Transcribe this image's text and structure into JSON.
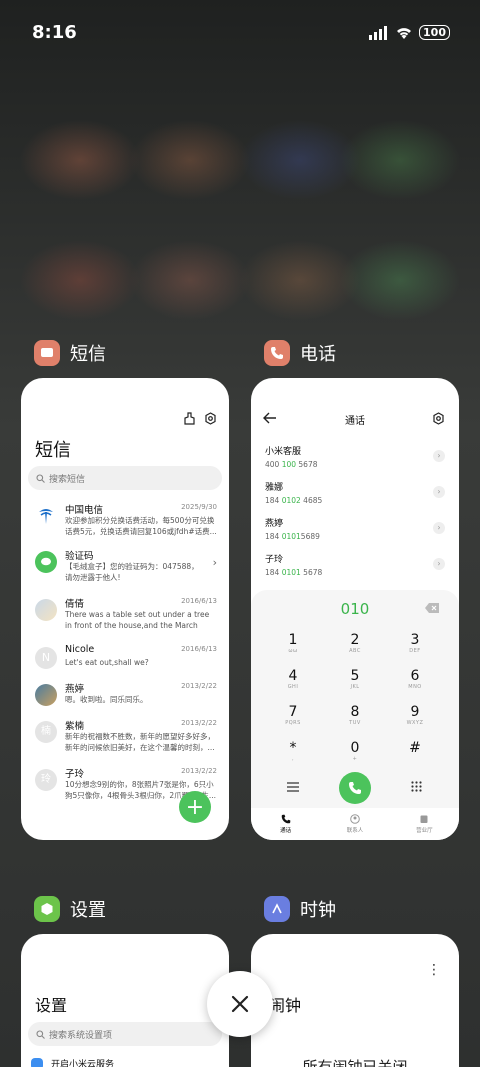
{
  "status": {
    "time": "8:16",
    "battery": "100"
  },
  "apps": {
    "sms": {
      "name": "短信",
      "title": "短信",
      "search_placeholder": "搜索短信"
    },
    "phone": {
      "name": "电话",
      "title": "通话"
    },
    "settings": {
      "name": "设置",
      "title": "设置",
      "search_placeholder": "搜索系统设置项",
      "first_item": "开启小米云服务"
    },
    "clock": {
      "name": "时钟",
      "title": "闹钟",
      "status": "所有闹钟已关闭"
    }
  },
  "messages": [
    {
      "name": "中国电信",
      "date": "2025/9/30",
      "preview": "欢迎参加积分兑换话费活动，每500分可兑换话费5元，兑换话费请回复106或jfdh#话费..."
    },
    {
      "name": "验证码",
      "date": "",
      "preview": "【毛绒盒子】您的验证码为：047588，请勿泄露于他人!"
    },
    {
      "name": "倩倩",
      "date": "2016/6/13",
      "preview": "There was a table set out under a tree in front of the house,and the March Hare an..."
    },
    {
      "name": "Nicole",
      "date": "2016/6/13",
      "preview": "Let's eat out,shall we?"
    },
    {
      "name": "燕婷",
      "date": "2013/2/22",
      "preview": "嗯。收到啦。同乐同乐。"
    },
    {
      "name": "紫楠",
      "date": "2013/2/22",
      "preview": "新年的祝福数不胜数，新年的愿望好多好多，新年的问候依旧美好，在这个温馨的时刻，..."
    },
    {
      "name": "子玲",
      "date": "2013/2/22",
      "preview": "10分想念9别的你，8张照片7张是你，6只小狗5只像你，4根骨头3根归你，2爪羁绊1生..."
    }
  ],
  "contacts": [
    {
      "name": "小米客服",
      "num_a": "400 ",
      "num_b": "100",
      "num_c": " 5678"
    },
    {
      "name": "雅娜",
      "num_a": "184 ",
      "num_b": "0102",
      "num_c": " 4685"
    },
    {
      "name": "燕婷",
      "num_a": "184 ",
      "num_b": "0101",
      "num_c": "5689"
    },
    {
      "name": "子玲",
      "num_a": "184 ",
      "num_b": "0101",
      "num_c": " 5678"
    }
  ],
  "dialer": {
    "number": "010",
    "keys": [
      {
        "d": "1",
        "l": "ωω"
      },
      {
        "d": "2",
        "l": "ABC"
      },
      {
        "d": "3",
        "l": "DEF"
      },
      {
        "d": "4",
        "l": "GHI"
      },
      {
        "d": "5",
        "l": "JKL"
      },
      {
        "d": "6",
        "l": "MNO"
      },
      {
        "d": "7",
        "l": "PQRS"
      },
      {
        "d": "8",
        "l": "TUV"
      },
      {
        "d": "9",
        "l": "WXYZ"
      },
      {
        "d": "*",
        "l": ","
      },
      {
        "d": "0",
        "l": "+"
      },
      {
        "d": "#",
        "l": ""
      }
    ],
    "tabs": [
      "通话",
      "联系人",
      "营业厅"
    ]
  },
  "colors": {
    "accent": "#4cc35c",
    "sms_icon": "#e0806a",
    "phone_icon": "#e0806a",
    "settings_icon": "#6cc44a",
    "clock_icon": "#6a7ee0"
  }
}
